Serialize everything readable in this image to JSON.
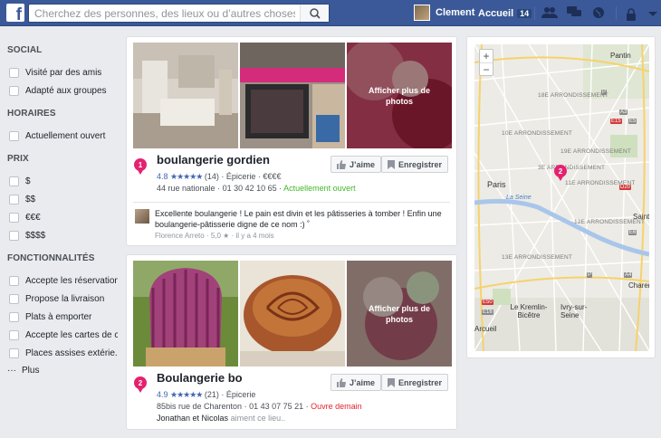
{
  "topbar": {
    "search_placeholder": "Cherchez des personnes, des lieux ou d’autres choses",
    "user_name": "Clement",
    "home_label": "Accueil",
    "home_count": "14"
  },
  "sidebar": {
    "sections": [
      {
        "title": "SOCIAL",
        "options": [
          "Visité par des amis",
          "Adapté aux groupes"
        ]
      },
      {
        "title": "HORAIRES",
        "options": [
          "Actuellement ouvert"
        ]
      },
      {
        "title": "PRIX",
        "options": [
          "$",
          "$$",
          "€€€",
          "$$$$"
        ]
      },
      {
        "title": "FONCTIONNALITÉS",
        "options": [
          "Accepte les réservations",
          "Propose la livraison",
          "Plats à emporter",
          "Accepte les cartes de c...",
          "Places assises extérie..."
        ]
      }
    ],
    "more_label": "Plus"
  },
  "results": [
    {
      "index": "1",
      "name": "boulangerie gordien",
      "rating": "4.8",
      "stars": "★★★★★",
      "reviews": "(14)",
      "category": "Épicerie",
      "price": "€€€€",
      "address": "44 rue nationale",
      "phone": "01 30 42 10 65",
      "status": "Actuellement ouvert",
      "more_photos": "Afficher plus de photos",
      "like_label": "J’aime",
      "save_label": "Enregistrer",
      "review": {
        "text": "Excellente boulangerie ! Le pain est divin et les pâtisseries à tomber ! Enfin une boulangerie-pâtisserie digne de ce nom :) ˚",
        "author": "Florence Arreto",
        "score": "5,0 ★",
        "when": "il y a 4 mois"
      }
    },
    {
      "index": "2",
      "name": "Boulangerie bo",
      "rating": "4.9",
      "stars": "★★★★★",
      "reviews": "(21)",
      "category": "Épicerie",
      "address": "85bis rue de Charenton",
      "phone": "01 43 07 75 21",
      "status": "Ouvre demain",
      "more_photos": "Afficher plus de photos",
      "like_label": "J’aime",
      "save_label": "Enregistrer",
      "friends": {
        "names": "Jonathan et Nicolas",
        "suffix": "aiment ce lieu.."
      }
    }
  ],
  "map": {
    "zoom_in": "+",
    "zoom_out": "−",
    "pin_label": "2",
    "labels": {
      "pantin": "Pantin",
      "arr18": "18E ARRONDISSEMENT",
      "arr10": "10E ARRONDISSEMENT",
      "arr19": "19E ARRONDISSEMENT",
      "arr3": "3E ARRONDISSEMENT",
      "arr11": "11E ARRONDISSEMENT",
      "arr12": "12E ARRONDISSEMENT",
      "arr13": "13E ARRONDISSEMENT",
      "paris": "Paris",
      "seine": "La Seine",
      "kremlin": "Le Kremlin-Bicêtre",
      "ivry": "Ivry-sur-Seine",
      "arcueil": "Arcueil",
      "charenton": "Charent le",
      "saint": "Saint Ma",
      "r1": "P",
      "r2": "A3",
      "r3": "E15",
      "r4": "E5",
      "r5": "D20",
      "r6": "E6",
      "r7": "P",
      "r8": "A4",
      "r9": "E50",
      "r10": "E16"
    }
  }
}
